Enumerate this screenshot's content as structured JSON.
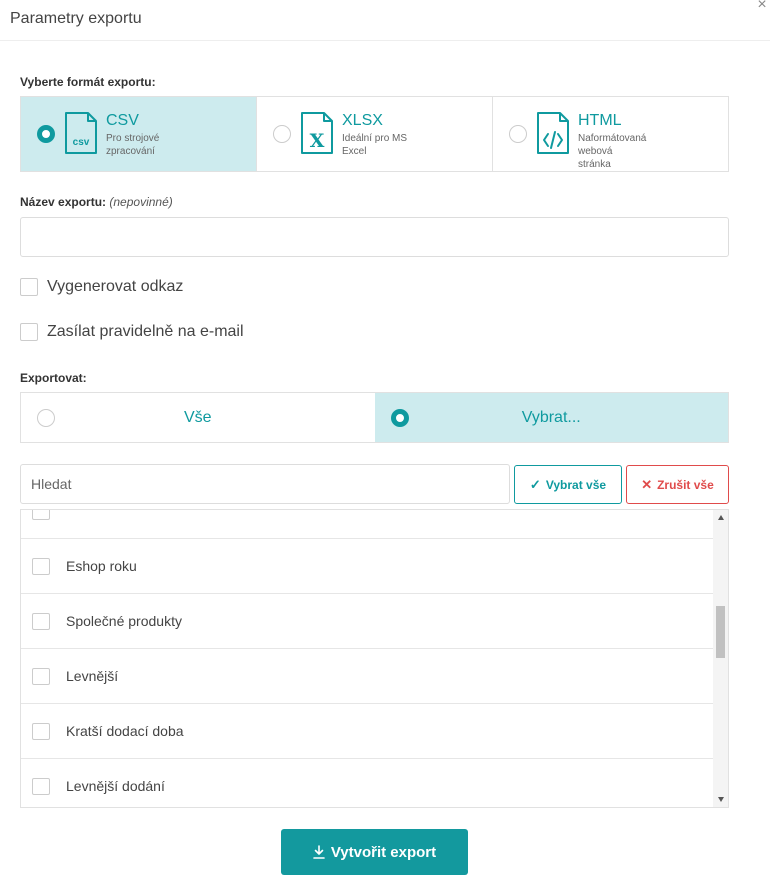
{
  "dialog": {
    "title": "Parametry exportu",
    "close": "×"
  },
  "format": {
    "label": "Vyberte formát exportu:",
    "options": [
      {
        "name": "CSV",
        "desc": "Pro strojové zpracování",
        "icon": "csv-file-icon",
        "selected": true
      },
      {
        "name": "XLSX",
        "desc": "Ideální pro MS Excel",
        "icon": "excel-file-icon",
        "selected": false
      },
      {
        "name": "HTML",
        "desc": "Naformátovaná webová stránka",
        "icon": "html-file-icon",
        "selected": false
      }
    ]
  },
  "export_name": {
    "label": "Název exportu:",
    "optional": "(nepovinné)",
    "value": "",
    "placeholder": ""
  },
  "checkboxes": {
    "generate_link": "Vygenerovat odkaz",
    "send_email": "Zasílat pravidelně na e-mail"
  },
  "scope": {
    "label": "Exportovat:",
    "all": "Vše",
    "select": "Vybrat..."
  },
  "search": {
    "placeholder": "Hledat"
  },
  "buttons": {
    "select_all": "Vybrat vše",
    "cancel_all": "Zrušit vše",
    "create": "Vytvořit export"
  },
  "items": [
    "",
    "Eshop roku",
    "Společné produkty",
    "Levnější",
    "Kratší dodací doba",
    "Levnější dodání"
  ],
  "colors": {
    "accent": "#0f9a9f",
    "selected_bg": "#cdebee",
    "danger": "#e04b4b"
  }
}
